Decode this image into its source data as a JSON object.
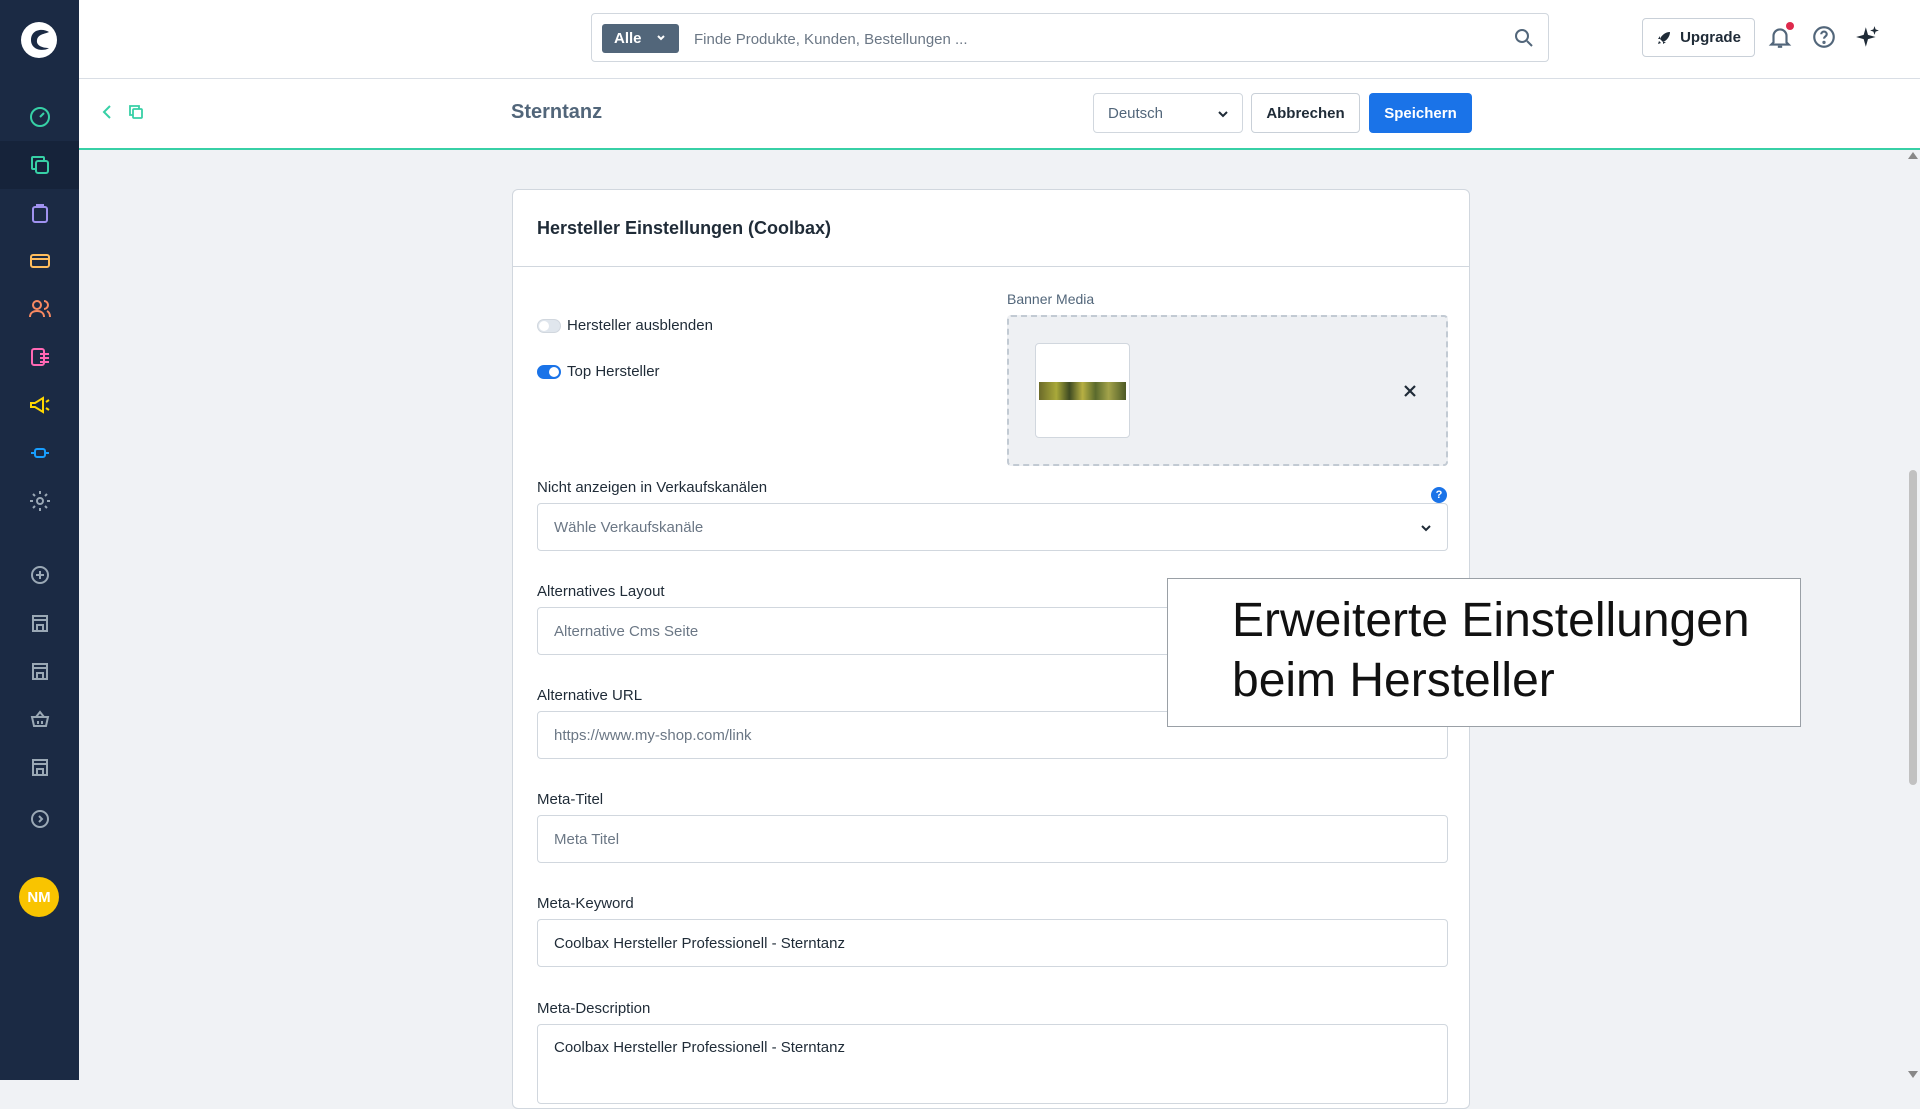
{
  "sidebar": {
    "items": [
      "dashboard-icon",
      "catalogue-icon",
      "orders-icon",
      "payments-icon",
      "customers-icon",
      "content-icon",
      "marketing-icon",
      "extensions-icon",
      "settings-icon"
    ],
    "extras": [
      "add-sales-channel-icon",
      "storefront-icon",
      "storefront-icon",
      "basket-icon",
      "storefront-icon",
      "expand-icon"
    ],
    "avatar": "NM"
  },
  "topbar": {
    "filter_label": "Alle",
    "search_placeholder": "Finde Produkte, Kunden, Bestellungen ...",
    "upgrade_label": "Upgrade"
  },
  "subheader": {
    "title": "Sterntanz",
    "language": "Deutsch",
    "cancel_label": "Abbrechen",
    "save_label": "Speichern"
  },
  "card": {
    "title": "Hersteller Einstellungen (Coolbax)",
    "switches": [
      {
        "label": "Hersteller ausblenden",
        "on": false
      },
      {
        "label": "Top Hersteller",
        "on": true
      }
    ],
    "banner_label": "Banner Media",
    "fields": [
      {
        "label": "Nicht anzeigen in Verkaufskanälen",
        "value": "",
        "placeholder": "Wähle Verkaufskanäle"
      },
      {
        "label": "Alternatives Layout",
        "value": "",
        "placeholder": "Alternative Cms Seite"
      },
      {
        "label": "Alternative URL",
        "value": "",
        "placeholder": "https://www.my-shop.com/link"
      },
      {
        "label": "Meta-Titel",
        "value": "",
        "placeholder": "Meta Titel"
      },
      {
        "label": "Meta-Keyword",
        "value": "Coolbax Hersteller Professionell - Sterntanz",
        "placeholder": ""
      },
      {
        "label": "Meta-Description",
        "value": "Coolbax Hersteller Professionell - Sterntanz",
        "placeholder": ""
      }
    ],
    "help_badge": "?"
  },
  "annotation": {
    "line1": "Erweiterte Einstellungen",
    "line2": "beim Hersteller"
  },
  "colors": {
    "sidebar_bg": "#1b2a44",
    "accent": "#1a73e8",
    "subheader_border": "#37d0a6",
    "avatar": "#f9c400"
  }
}
